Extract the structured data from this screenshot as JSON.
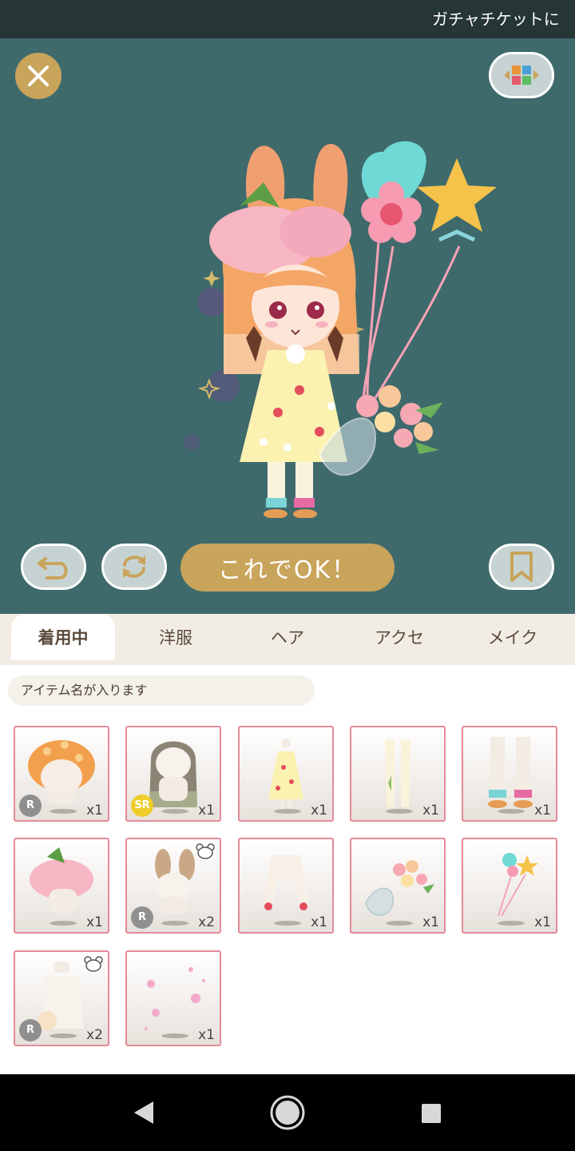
{
  "ticker": {
    "text": "ガチャチケットに"
  },
  "stage": {
    "ok_label": "これでOK！"
  },
  "tabs": [
    {
      "label": "着用中",
      "active": true
    },
    {
      "label": "洋服",
      "active": false
    },
    {
      "label": "ヘア",
      "active": false
    },
    {
      "label": "アクセ",
      "active": false
    },
    {
      "label": "メイク",
      "active": false
    }
  ],
  "item_name": "アイテム名が入ります",
  "items": [
    {
      "name": "mushroom-hair",
      "qty": "x1",
      "rarity": "R",
      "bear": false
    },
    {
      "name": "long-brown-hair",
      "qty": "x1",
      "rarity": "SR",
      "bear": false
    },
    {
      "name": "strawberry-dress",
      "qty": "x1",
      "rarity": "",
      "bear": false
    },
    {
      "name": "leaf-tights",
      "qty": "x1",
      "rarity": "",
      "bear": false
    },
    {
      "name": "rainbow-socks",
      "qty": "x1",
      "rarity": "",
      "bear": false
    },
    {
      "name": "flower-hat",
      "qty": "x1",
      "rarity": "",
      "bear": false
    },
    {
      "name": "bunny-ears",
      "qty": "x2",
      "rarity": "R",
      "bear": true
    },
    {
      "name": "white-sweater",
      "qty": "x1",
      "rarity": "",
      "bear": false
    },
    {
      "name": "flower-bouquet",
      "qty": "x1",
      "rarity": "",
      "bear": false
    },
    {
      "name": "balloons",
      "qty": "x1",
      "rarity": "",
      "bear": false
    },
    {
      "name": "knit-back",
      "qty": "x2",
      "rarity": "R",
      "bear": true
    },
    {
      "name": "sparkle-effect",
      "qty": "x1",
      "rarity": "",
      "bear": false
    }
  ],
  "colors": {
    "stage": "#3f6a6c",
    "gold": "#c9a45b",
    "pill": "#c6d3d2",
    "item_border": "#e58a99"
  }
}
